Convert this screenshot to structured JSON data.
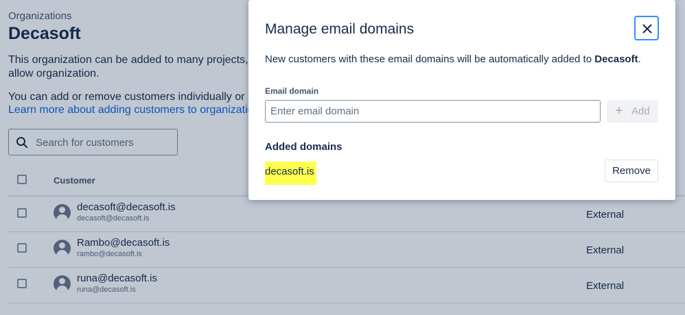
{
  "page": {
    "breadcrumb": "Organizations",
    "title": "Decasoft",
    "description_1": "This organization can be added to many projects, allow organization.",
    "description_2": "You can add or remove customers individually or use e",
    "learn_more_link": "Learn more about adding customers to organizations",
    "search": {
      "placeholder": "Search for customers"
    },
    "table": {
      "column_customer": "Customer",
      "rows": [
        {
          "name": "decasoft@decasoft.is",
          "email": "decasoft@decasoft.is",
          "type": "External"
        },
        {
          "name": "Rambo@decasoft.is",
          "email": "rambo@decasoft.is",
          "type": "External"
        },
        {
          "name": "runa@decasoft.is",
          "email": "runa@decasoft.is",
          "type": "External"
        }
      ]
    }
  },
  "modal": {
    "title": "Manage email domains",
    "description_prefix": "New customers with these email domains will be automatically added to ",
    "description_org": "Decasoft",
    "description_suffix": ".",
    "field_label": "Email domain",
    "field_placeholder": "Enter email domain",
    "field_value": "",
    "add_label": "Add",
    "added_heading": "Added domains",
    "domains": [
      {
        "domain": "decasoft.is",
        "action": "Remove"
      }
    ]
  },
  "colors": {
    "link": "#0c66e4",
    "focus_border": "#388bff",
    "highlight": "#ffff4d",
    "text": "#172b4d"
  },
  "icons": [
    "search-icon",
    "close-icon",
    "plus-icon",
    "user-avatar-icon",
    "checkbox"
  ]
}
